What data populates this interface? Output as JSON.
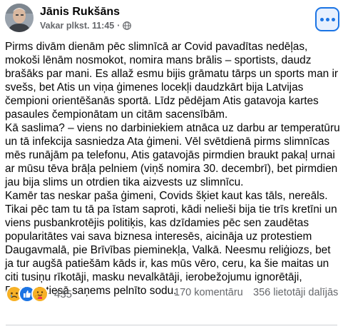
{
  "post": {
    "author": "Jānis Rukšāns",
    "timestamp": "Vakar plkst. 11:45",
    "separator": "·",
    "audience_icon": "globe-icon",
    "menu_icon": "more-horizontal-icon",
    "paragraphs": [
      "Pirms divām dienām pēc slimnīcā ar Covid pavadītas nedēļas, mokoši lēnām nosmokot, nomira mans brālis – sportists, daudz brašāks par mani. Es allaž esmu bijis grāmatu tārps un sports man ir svešs, bet Atis un viņa ģimenes locekļi daudzkārt bija Latvijas čempioni orientēšanās sportā. Līdz pēdējam Atis gatavoja kartes pasaules čempionātam un citām sacensībām.",
      "Kā saslima? – viens no darbiniekiem atnāca uz darbu ar temperatūru un tā infekcija sasniedza Ata ģimeni. Vēl svētdienā pirms slimnīcas mēs runājām pa telefonu, Atis gatavojās pirmdien braukt pakaļ urnai ar mūsu tēva brāļa pelniem (viņš nomira 30. decembrī), bet pirmdien jau bija slims un otrdien tika aizvests uz slimnīcu.",
      "Kamēr tas neskar paša ģimeni, Covids šķiet kaut kas tāls, nereāls. Tikai pēc tam tu tā pa īstam saproti, kādi nelieši bija tie trīs kretīni un viens pusbankrotējis politiķis, kas dzīdamies pēc sen zaudētas popularitātes vai sava biznesa interesēs, aicināja uz protestiem Daugavmalā, pie Brīvības pieminekļa, Valkā. Neesmu reliģiozs, bet ja tur augšā patiešām kāds ir, kas mūs vēro, ceru, ka šie maitas un citi tusiņu rīkotāji, masku nevalkātāji, ierobežojumu ignorētāji, Pastarā tiesā saņems pelnīto sodu."
    ],
    "reactions": {
      "icons": [
        "sad-reaction-icon",
        "like-reaction-icon",
        "care-reaction-icon"
      ],
      "count": "435"
    },
    "comments": "170 komentāru",
    "shares": "356 lietotāji dalījās"
  },
  "colors": {
    "accent": "#1b74e4",
    "secondary_text": "#65676b",
    "primary_text": "#050505"
  }
}
